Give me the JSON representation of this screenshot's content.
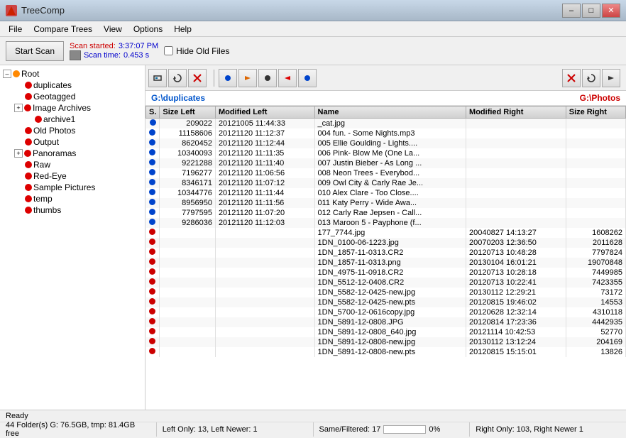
{
  "titleBar": {
    "title": "TreeComp",
    "icon": "T",
    "controls": [
      "–",
      "□",
      "✕"
    ]
  },
  "menu": {
    "items": [
      "File",
      "Compare Trees",
      "View",
      "Options",
      "Help"
    ]
  },
  "toolbar": {
    "startScanLabel": "Start Scan",
    "scanStartedLabel": "Scan started:",
    "scanStartedValue": "3:37:07 PM",
    "scanTimeLabel": "Scan time:",
    "scanTimeValue": "0.453 s",
    "hideOldFilesLabel": "Hide Old Files"
  },
  "compareToolbar": {
    "leftPath": "G:\\duplicates",
    "rightPath": "G:\\Photos",
    "buttons": [
      "←",
      "→",
      "●",
      "→",
      "●",
      "←",
      "●",
      "✕",
      "↻",
      "→"
    ]
  },
  "tree": {
    "nodes": [
      {
        "label": "Root",
        "level": 0,
        "expand": true,
        "dot": "orange"
      },
      {
        "label": "duplicates",
        "level": 1,
        "dot": "red"
      },
      {
        "label": "Geotagged",
        "level": 1,
        "dot": "red"
      },
      {
        "label": "Image Archives",
        "level": 1,
        "dot": "red",
        "expand": false
      },
      {
        "label": "archive1",
        "level": 2,
        "dot": "red"
      },
      {
        "label": "Old Photos",
        "level": 1,
        "dot": "red"
      },
      {
        "label": "Output",
        "level": 1,
        "dot": "red"
      },
      {
        "label": "Panoramas",
        "level": 1,
        "dot": "red",
        "expand": false
      },
      {
        "label": "Raw",
        "level": 1,
        "dot": "red"
      },
      {
        "label": "Red-Eye",
        "level": 1,
        "dot": "red"
      },
      {
        "label": "Sample Pictures",
        "level": 1,
        "dot": "red"
      },
      {
        "label": "temp",
        "level": 1,
        "dot": "red"
      },
      {
        "label": "thumbs",
        "level": 1,
        "dot": "red"
      }
    ]
  },
  "tableHeaders": [
    "S.",
    "Size Left",
    "Modified Left",
    "Name",
    "Modified Right",
    "Size Right"
  ],
  "tableRows": [
    {
      "dot": "diamond",
      "sizeLeft": "209022",
      "modLeft": "20121005 11:44:33",
      "name": "_cat.jpg",
      "modRight": "",
      "sizeRight": ""
    },
    {
      "dot": "blue",
      "sizeLeft": "11158606",
      "modLeft": "20121120 11:12:37",
      "name": "004 fun. - Some Nights.mp3",
      "modRight": "",
      "sizeRight": ""
    },
    {
      "dot": "blue",
      "sizeLeft": "8620452",
      "modLeft": "20121120 11:12:44",
      "name": "005 Ellie Goulding - Lights....",
      "modRight": "",
      "sizeRight": ""
    },
    {
      "dot": "blue",
      "sizeLeft": "10340093",
      "modLeft": "20121120 11:11:35",
      "name": "006 Pink- Blow Me (One La...",
      "modRight": "",
      "sizeRight": ""
    },
    {
      "dot": "blue",
      "sizeLeft": "9221288",
      "modLeft": "20121120 11:11:40",
      "name": "007 Justin Bieber - As Long ...",
      "modRight": "",
      "sizeRight": ""
    },
    {
      "dot": "blue",
      "sizeLeft": "7196277",
      "modLeft": "20121120 11:06:56",
      "name": "008 Neon Trees - Everybod...",
      "modRight": "",
      "sizeRight": ""
    },
    {
      "dot": "blue",
      "sizeLeft": "8346171",
      "modLeft": "20121120 11:07:12",
      "name": "009 Owl City & Carly Rae Je...",
      "modRight": "",
      "sizeRight": ""
    },
    {
      "dot": "blue",
      "sizeLeft": "10344776",
      "modLeft": "20121120 11:11:44",
      "name": "010 Alex Clare - Too Close....",
      "modRight": "",
      "sizeRight": ""
    },
    {
      "dot": "blue",
      "sizeLeft": "8956950",
      "modLeft": "20121120 11:11:56",
      "name": "011 Katy Perry - Wide Awa...",
      "modRight": "",
      "sizeRight": ""
    },
    {
      "dot": "blue",
      "sizeLeft": "7797595",
      "modLeft": "20121120 11:07:20",
      "name": "012 Carly Rae Jepsen - Call...",
      "modRight": "",
      "sizeRight": ""
    },
    {
      "dot": "blue",
      "sizeLeft": "9286036",
      "modLeft": "20121120 11:12:03",
      "name": "013 Maroon 5 - Payphone (f...",
      "modRight": "",
      "sizeRight": ""
    },
    {
      "dot": "red",
      "sizeLeft": "",
      "modLeft": "",
      "name": "177_7744.jpg",
      "modRight": "20040827 14:13:27",
      "sizeRight": "1608262"
    },
    {
      "dot": "red",
      "sizeLeft": "",
      "modLeft": "",
      "name": "1DN_0100-06-1223.jpg",
      "modRight": "20070203 12:36:50",
      "sizeRight": "2011628"
    },
    {
      "dot": "red",
      "sizeLeft": "",
      "modLeft": "",
      "name": "1DN_1857-11-0313.CR2",
      "modRight": "20120713 10:48:28",
      "sizeRight": "7797824"
    },
    {
      "dot": "red",
      "sizeLeft": "",
      "modLeft": "",
      "name": "1DN_1857-11-0313.png",
      "modRight": "20130104 16:01:21",
      "sizeRight": "19070848"
    },
    {
      "dot": "red",
      "sizeLeft": "",
      "modLeft": "",
      "name": "1DN_4975-11-0918.CR2",
      "modRight": "20120713 10:28:18",
      "sizeRight": "7449985"
    },
    {
      "dot": "red",
      "sizeLeft": "",
      "modLeft": "",
      "name": "1DN_5512-12-0408.CR2",
      "modRight": "20120713 10:22:41",
      "sizeRight": "7423355"
    },
    {
      "dot": "red",
      "sizeLeft": "",
      "modLeft": "",
      "name": "1DN_5582-12-0425-new.jpg",
      "modRight": "20130112 12:29:21",
      "sizeRight": "73172"
    },
    {
      "dot": "red",
      "sizeLeft": "",
      "modLeft": "",
      "name": "1DN_5582-12-0425-new.pts",
      "modRight": "20120815 19:46:02",
      "sizeRight": "14553"
    },
    {
      "dot": "red",
      "sizeLeft": "",
      "modLeft": "",
      "name": "1DN_5700-12-0616copy.jpg",
      "modRight": "20120628 12:32:14",
      "sizeRight": "4310118"
    },
    {
      "dot": "red",
      "sizeLeft": "",
      "modLeft": "",
      "name": "1DN_5891-12-0808.JPG",
      "modRight": "20120814 17:23:36",
      "sizeRight": "4442935"
    },
    {
      "dot": "red",
      "sizeLeft": "",
      "modLeft": "",
      "name": "1DN_5891-12-0808_640.jpg",
      "modRight": "20121114 10:42:53",
      "sizeRight": "52770"
    },
    {
      "dot": "red",
      "sizeLeft": "",
      "modLeft": "",
      "name": "1DN_5891-12-0808-new.jpg",
      "modRight": "20130112 13:12:24",
      "sizeRight": "204169"
    },
    {
      "dot": "red",
      "sizeLeft": "",
      "modLeft": "",
      "name": "1DN_5891-12-0808-new.pts",
      "modRight": "20120815 15:15:01",
      "sizeRight": "13826"
    }
  ],
  "statusBar": {
    "ready": "Ready",
    "diskInfo": "44 Folder(s) G: 76.5GB, tmp: 81.4GB free",
    "leftOnly": "Left Only: 13, Left Newer: 1",
    "sameFiltered": "Same/Filtered: 17",
    "rightOnly": "Right Only: 103, Right Newer 1",
    "progress": "0%"
  }
}
